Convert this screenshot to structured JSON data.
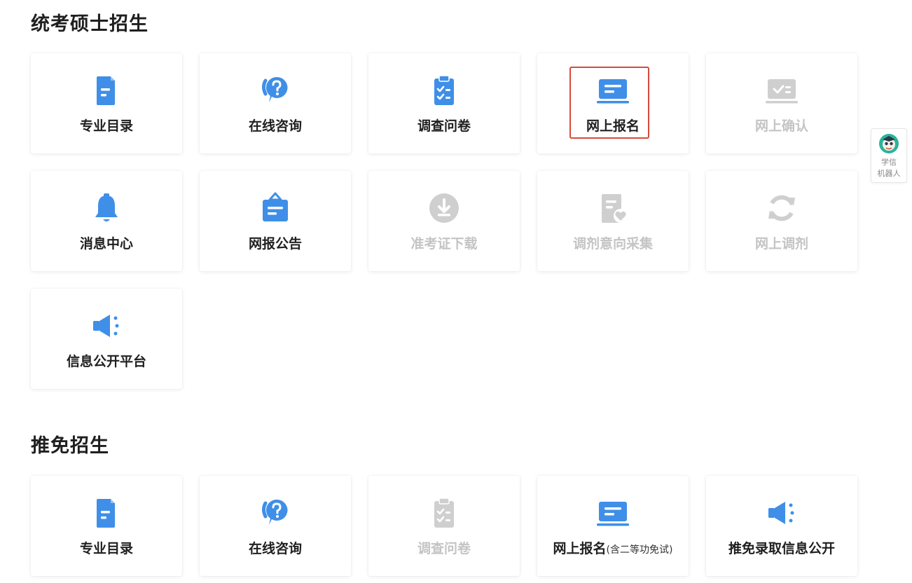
{
  "colors": {
    "accent": "#3f8fe8",
    "disabled": "#cfcfcf",
    "highlight": "#d64a3b"
  },
  "sections": [
    {
      "title": "统考硕士招生",
      "cards": [
        {
          "label": "专业目录",
          "icon": "document-icon",
          "enabled": true
        },
        {
          "label": "在线咨询",
          "icon": "help-chat-icon",
          "enabled": true
        },
        {
          "label": "调查问卷",
          "icon": "clipboard-check-icon",
          "enabled": true
        },
        {
          "label": "网上报名",
          "icon": "laptop-icon",
          "enabled": true,
          "highlighted": true
        },
        {
          "label": "网上确认",
          "icon": "confirm-screen-icon",
          "enabled": false
        },
        {
          "label": "消息中心",
          "icon": "bell-icon",
          "enabled": true
        },
        {
          "label": "网报公告",
          "icon": "notice-board-icon",
          "enabled": true
        },
        {
          "label": "准考证下载",
          "icon": "download-icon",
          "enabled": false
        },
        {
          "label": "调剂意向采集",
          "icon": "doc-heart-icon",
          "enabled": false
        },
        {
          "label": "网上调剂",
          "icon": "refresh-icon",
          "enabled": false
        },
        {
          "label": "信息公开平台",
          "icon": "megaphone-icon",
          "enabled": true
        }
      ]
    },
    {
      "title": "推免招生",
      "cards": [
        {
          "label": "专业目录",
          "icon": "document-icon",
          "enabled": true
        },
        {
          "label": "在线咨询",
          "icon": "help-chat-icon",
          "enabled": true
        },
        {
          "label": "调查问卷",
          "icon": "clipboard-check-icon",
          "enabled": false
        },
        {
          "label": "网上报名",
          "sub": "(含二等功免试)",
          "icon": "laptop-icon",
          "enabled": true
        },
        {
          "label": "推免录取信息公开",
          "icon": "megaphone-icon",
          "enabled": true
        }
      ]
    }
  ],
  "robot": {
    "line1": "学信",
    "line2": "机器人"
  }
}
